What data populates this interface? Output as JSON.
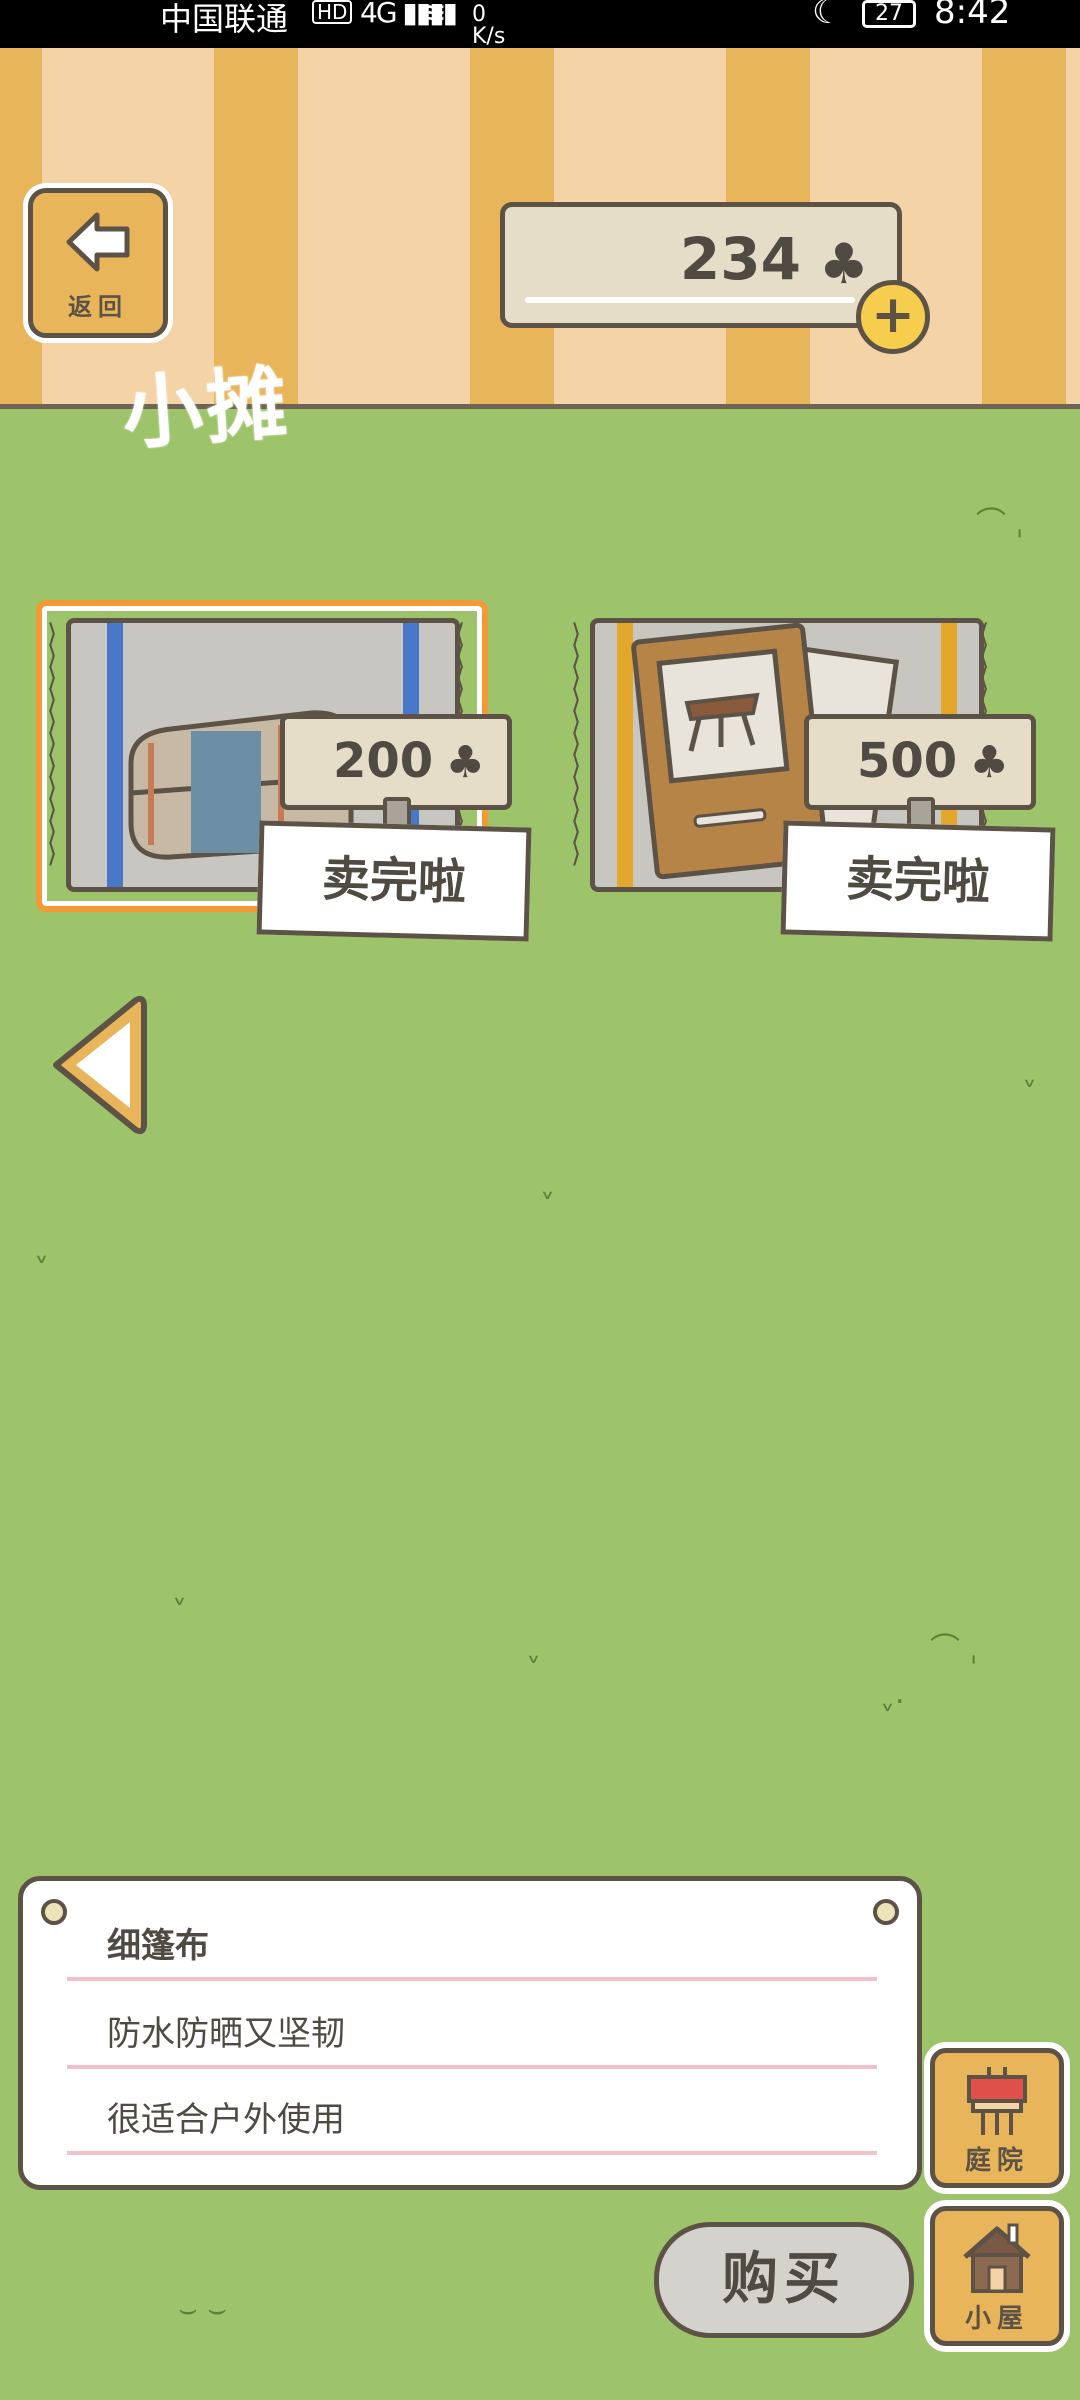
{
  "status_bar": {
    "carrier": "中国联通",
    "hd": "HD",
    "signal": "4G ▮▮▮▮",
    "speed_value": "0",
    "speed_unit": "K/s",
    "battery": "27",
    "time": "8:42"
  },
  "header": {
    "back_label": "返回",
    "title": "小摊",
    "coin_count": "234",
    "coin_icon": "♣",
    "plus_icon": "+"
  },
  "items": [
    {
      "price": "200",
      "currency_icon": "♣",
      "status": "卖完啦",
      "selected": true
    },
    {
      "price": "500",
      "currency_icon": "♣",
      "status": "卖完啦",
      "selected": false
    }
  ],
  "description": {
    "name": "细篷布",
    "line1": "防水防晒又坚韧",
    "line2": "很适合户外使用"
  },
  "side_buttons": {
    "yard_label": "庭院",
    "house_label": "小屋"
  },
  "buy_label": "购买",
  "colors": {
    "grass": "#9dc46a",
    "stripe_dark": "#e9b55a",
    "stripe_light": "#f4d3a7",
    "outline": "#5c5346",
    "selected_border": "#f39a37"
  }
}
